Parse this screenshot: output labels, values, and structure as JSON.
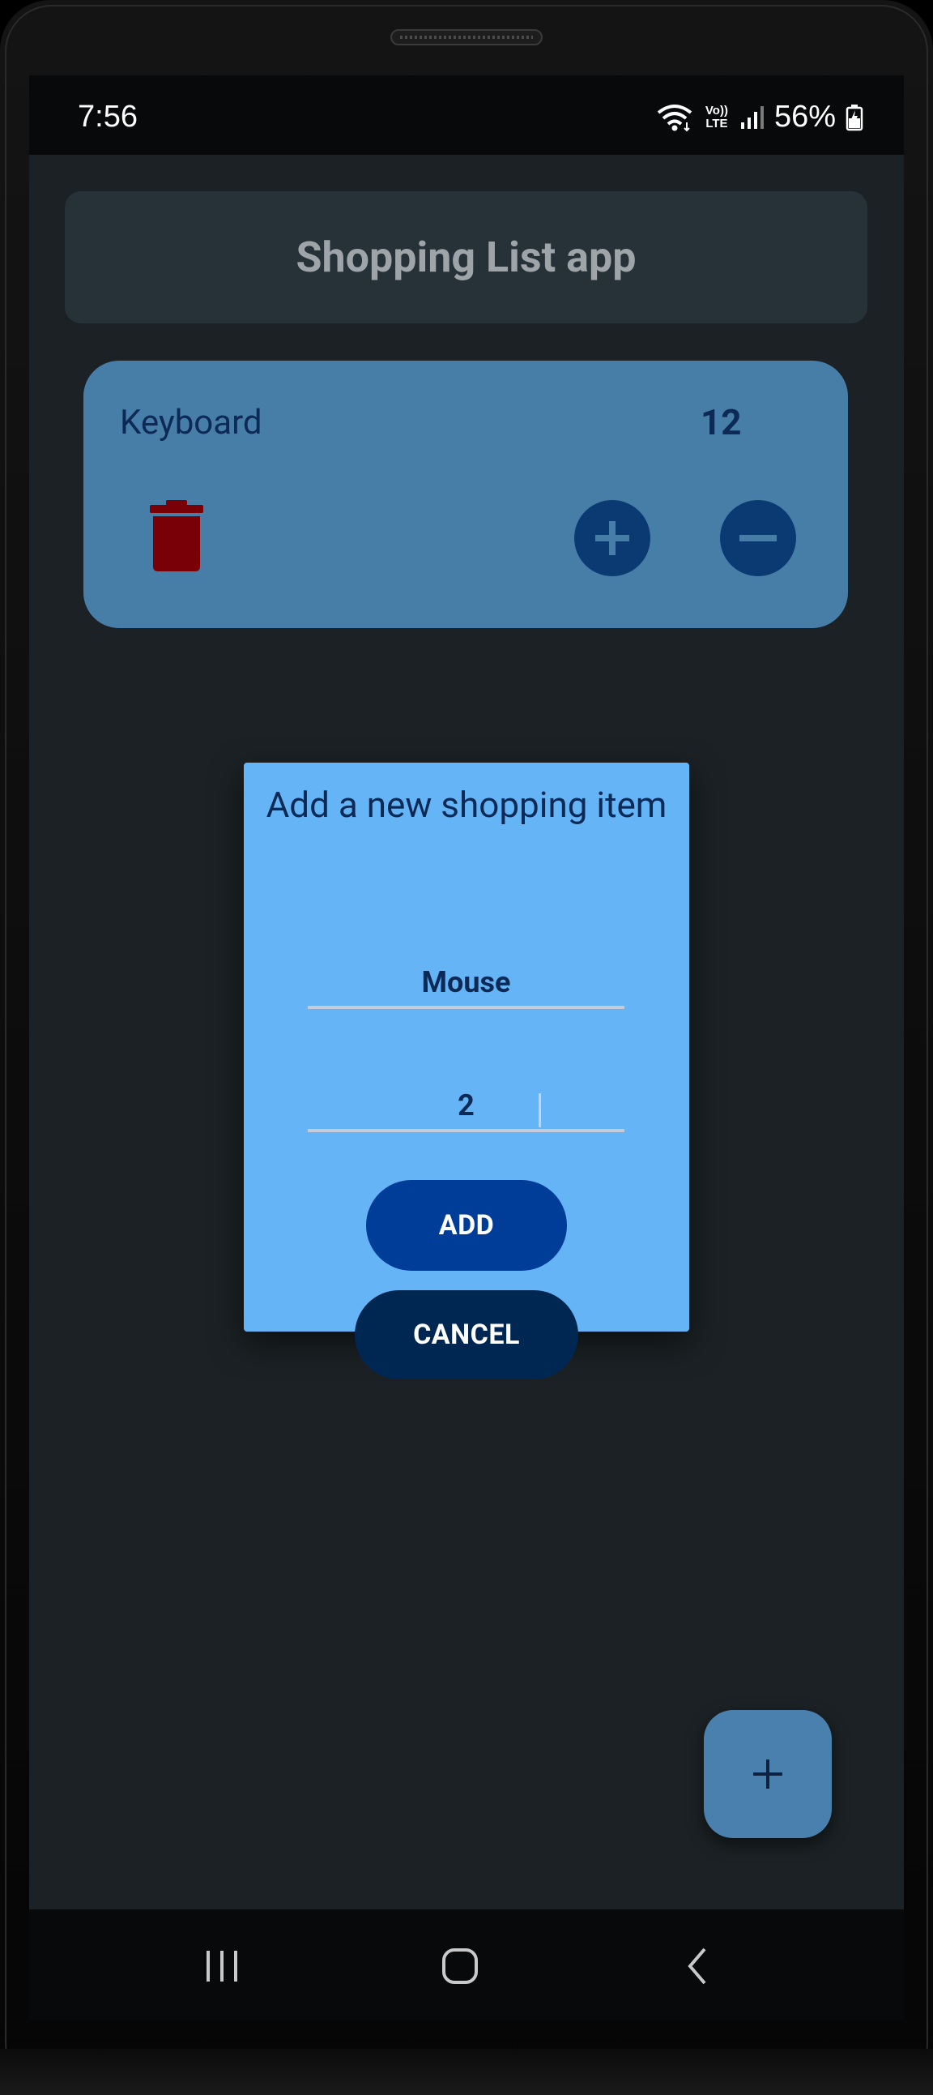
{
  "status_bar": {
    "time": "7:56",
    "volte_top": "Vo))",
    "volte_bottom": "LTE",
    "battery": "56%"
  },
  "app": {
    "title": "Shopping List app"
  },
  "items": [
    {
      "name": "Keyboard",
      "quantity": "12"
    }
  ],
  "dialog": {
    "title": "Add a new shopping item",
    "name_value": "Mouse",
    "quantity_value": "2",
    "add_label": "ADD",
    "cancel_label": "CANCEL"
  },
  "fab": {
    "label": "+"
  },
  "colors": {
    "background": "#1b2124",
    "title_card": "#263238",
    "item_card": "#467ea8",
    "dialog": "#65b5f6",
    "add_button": "#003d99",
    "cancel_button": "#002752",
    "delete_icon": "#7a0008",
    "fab": "#4a80ad"
  },
  "icons": {
    "delete": "trash-icon",
    "increment": "plus-circle-icon",
    "decrement": "minus-circle-icon",
    "fab": "plus-icon",
    "nav_recents": "recents-icon",
    "nav_home": "home-icon",
    "nav_back": "back-icon"
  }
}
